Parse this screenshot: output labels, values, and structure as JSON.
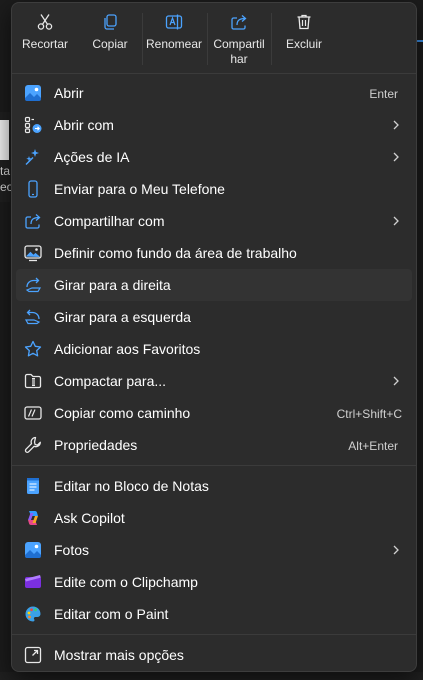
{
  "toolbar": {
    "cut": "Recortar",
    "copy": "Copiar",
    "rename": "Renomear",
    "share_line1": "Compartil",
    "share_line2": "har",
    "delete": "Excluir"
  },
  "background": {
    "frag1": "ta",
    "frag2": "eo"
  },
  "menu": {
    "open": {
      "label": "Abrir",
      "accel": "Enter"
    },
    "open_with": {
      "label": "Abrir com"
    },
    "ai_actions": {
      "label": "Ações de IA"
    },
    "send_phone": {
      "label": "Enviar para o Meu Telefone"
    },
    "share_with": {
      "label": "Compartilhar com"
    },
    "set_wallpaper": {
      "label": "Definir como fundo da área de trabalho"
    },
    "rotate_right": {
      "label": "Girar para a direita"
    },
    "rotate_left": {
      "label": "Girar para a esquerda"
    },
    "add_favorites": {
      "label": "Adicionar aos Favoritos"
    },
    "compress": {
      "label": "Compactar para..."
    },
    "copy_path": {
      "label": "Copiar como caminho",
      "accel": "Ctrl+Shift+C"
    },
    "properties": {
      "label": "Propriedades",
      "accel": "Alt+Enter"
    },
    "notepad": {
      "label": "Editar no Bloco de Notas"
    },
    "copilot": {
      "label": "Ask Copilot"
    },
    "photos": {
      "label": "Fotos"
    },
    "clipchamp": {
      "label": "Edite com o Clipchamp"
    },
    "paint": {
      "label": "Editar com o Paint"
    },
    "more_options": {
      "label": "Mostrar mais opções"
    }
  },
  "colors": {
    "accent": "#4ba3ff",
    "menu_bg": "#2c2c2c",
    "separator": "#3b3b3b"
  }
}
